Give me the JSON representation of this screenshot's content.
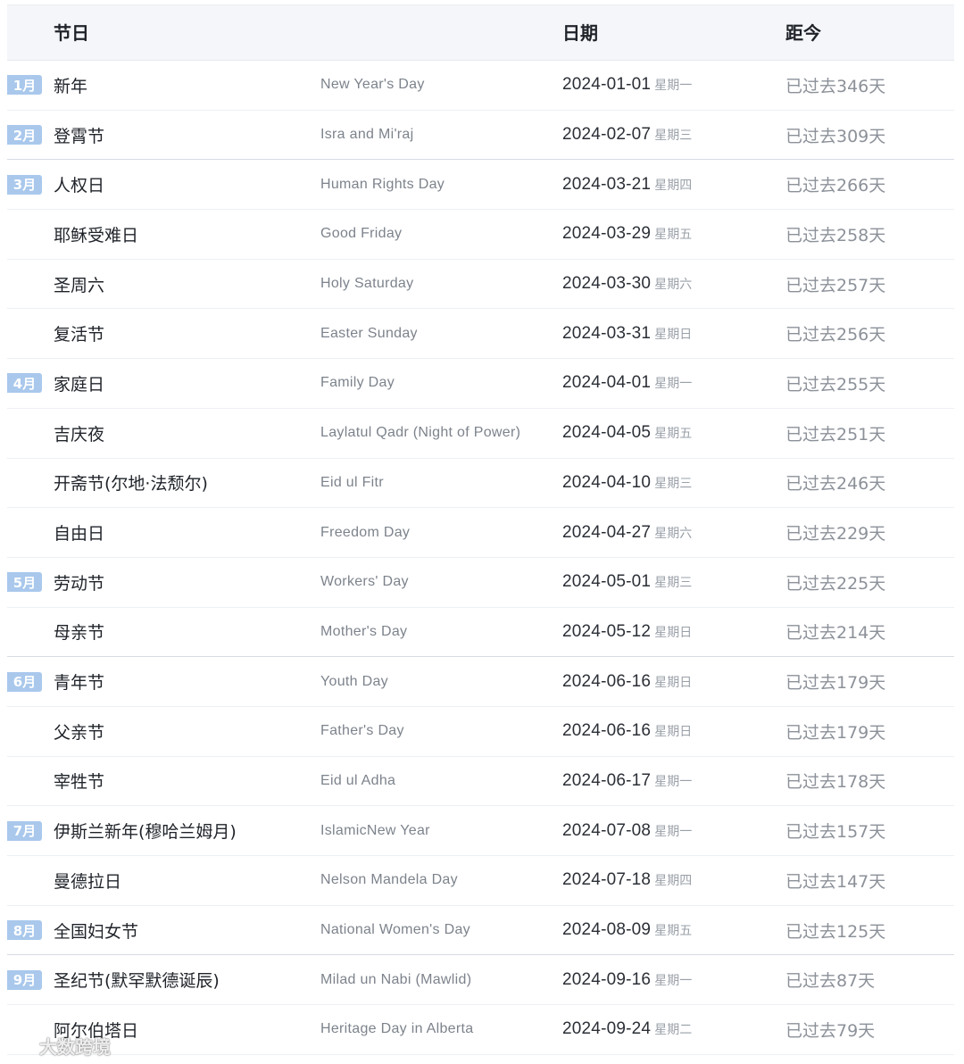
{
  "header": {
    "holiday": "节日",
    "date": "日期",
    "since": "距今"
  },
  "rows": [
    {
      "month": "1月",
      "cn": "新年",
      "en": "New Year's Day",
      "date": "2024-01-01",
      "weekday": "星期一",
      "ago": "已过去346天"
    },
    {
      "month": "2月",
      "cn": "登霄节",
      "en": "Isra and Mi'raj",
      "date": "2024-02-07",
      "weekday": "星期三",
      "ago": "已过去309天"
    },
    {
      "month": "3月",
      "cn": "人权日",
      "en": "Human Rights Day",
      "date": "2024-03-21",
      "weekday": "星期四",
      "ago": "已过去266天"
    },
    {
      "month": "",
      "cn": "耶稣受难日",
      "en": "Good Friday",
      "date": "2024-03-29",
      "weekday": "星期五",
      "ago": "已过去258天"
    },
    {
      "month": "",
      "cn": "圣周六",
      "en": "Holy Saturday",
      "date": "2024-03-30",
      "weekday": "星期六",
      "ago": "已过去257天"
    },
    {
      "month": "",
      "cn": "复活节",
      "en": "Easter Sunday",
      "date": "2024-03-31",
      "weekday": "星期日",
      "ago": "已过去256天"
    },
    {
      "month": "4月",
      "cn": "家庭日",
      "en": "Family Day",
      "date": "2024-04-01",
      "weekday": "星期一",
      "ago": "已过去255天"
    },
    {
      "month": "",
      "cn": "吉庆夜",
      "en": "Laylatul Qadr (Night of Power)",
      "date": "2024-04-05",
      "weekday": "星期五",
      "ago": "已过去251天"
    },
    {
      "month": "",
      "cn": "开斋节(尔地·法颓尔)",
      "en": "Eid ul Fitr",
      "date": "2024-04-10",
      "weekday": "星期三",
      "ago": "已过去246天"
    },
    {
      "month": "",
      "cn": "自由日",
      "en": "Freedom Day",
      "date": "2024-04-27",
      "weekday": "星期六",
      "ago": "已过去229天"
    },
    {
      "month": "5月",
      "cn": "劳动节",
      "en": "Workers' Day",
      "date": "2024-05-01",
      "weekday": "星期三",
      "ago": "已过去225天"
    },
    {
      "month": "",
      "cn": "母亲节",
      "en": "Mother's Day",
      "date": "2024-05-12",
      "weekday": "星期日",
      "ago": "已过去214天"
    },
    {
      "month": "6月",
      "cn": "青年节",
      "en": "Youth Day",
      "date": "2024-06-16",
      "weekday": "星期日",
      "ago": "已过去179天"
    },
    {
      "month": "",
      "cn": "父亲节",
      "en": "Father's Day",
      "date": "2024-06-16",
      "weekday": "星期日",
      "ago": "已过去179天"
    },
    {
      "month": "",
      "cn": "宰牲节",
      "en": "Eid ul Adha",
      "date": "2024-06-17",
      "weekday": "星期一",
      "ago": "已过去178天"
    },
    {
      "month": "7月",
      "cn": "伊斯兰新年(穆哈兰姆月)",
      "en": "IslamicNew Year",
      "date": "2024-07-08",
      "weekday": "星期一",
      "ago": "已过去157天"
    },
    {
      "month": "",
      "cn": "曼德拉日",
      "en": "Nelson Mandela Day",
      "date": "2024-07-18",
      "weekday": "星期四",
      "ago": "已过去147天"
    },
    {
      "month": "8月",
      "cn": "全国妇女节",
      "en": "National Women's Day",
      "date": "2024-08-09",
      "weekday": "星期五",
      "ago": "已过去125天"
    },
    {
      "month": "9月",
      "cn": "圣纪节(默罕默德诞辰)",
      "en": "Milad un Nabi (Mawlid)",
      "date": "2024-09-16",
      "weekday": "星期一",
      "ago": "已过去87天"
    },
    {
      "month": "",
      "cn": "阿尔伯塔日",
      "en": "Heritage Day in Alberta",
      "date": "2024-09-24",
      "weekday": "星期二",
      "ago": "已过去79天"
    }
  ],
  "watermark": {
    "icon": "weibo-icon",
    "text": "大数跨境"
  }
}
